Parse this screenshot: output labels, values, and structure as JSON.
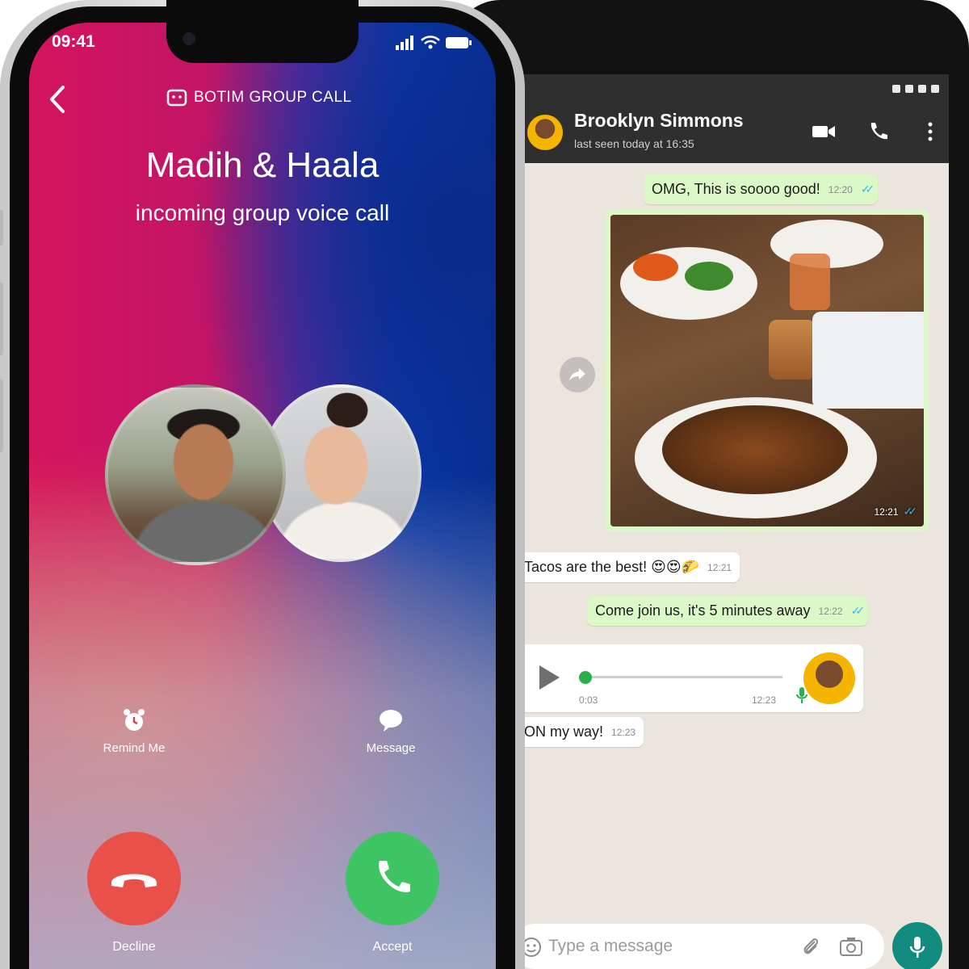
{
  "left_phone": {
    "status_time": "09:41",
    "call_type_label": "BOTIM GROUP CALL",
    "caller_name": "Madih & Haala",
    "call_subtitle": "incoming group voice call",
    "actions": {
      "remind_label": "Remind Me",
      "message_label": "Message"
    },
    "buttons": {
      "decline_label": "Decline",
      "accept_label": "Accept"
    },
    "colors": {
      "decline": "#e9504a",
      "accept": "#3fc463"
    }
  },
  "right_phone": {
    "contact_name": "Brooklyn Simmons",
    "last_seen": "last seen today at 16:35",
    "messages": [
      {
        "text": "OMG, This is soooo good!",
        "time": "12:20",
        "direction": "out"
      },
      {
        "text": "",
        "time": "12:21",
        "direction": "out",
        "type": "photo"
      },
      {
        "text": "Tacos are the best! 😍😍🌮",
        "time": "12:21",
        "direction": "in"
      },
      {
        "text": "Come join us, it's 5 minutes away",
        "time": "12:22",
        "direction": "out"
      },
      {
        "text": "",
        "time": "12:23",
        "direction": "in",
        "type": "voice",
        "duration": "0:03"
      },
      {
        "text": "ON my way!",
        "time": "12:23",
        "direction": "in"
      }
    ],
    "input_placeholder": "Type a message",
    "colors": {
      "header": "#2f2f2f",
      "outgoing": "#dcf8c6",
      "chat_bg": "#ece5dd",
      "mic_button": "#128c7e"
    }
  }
}
